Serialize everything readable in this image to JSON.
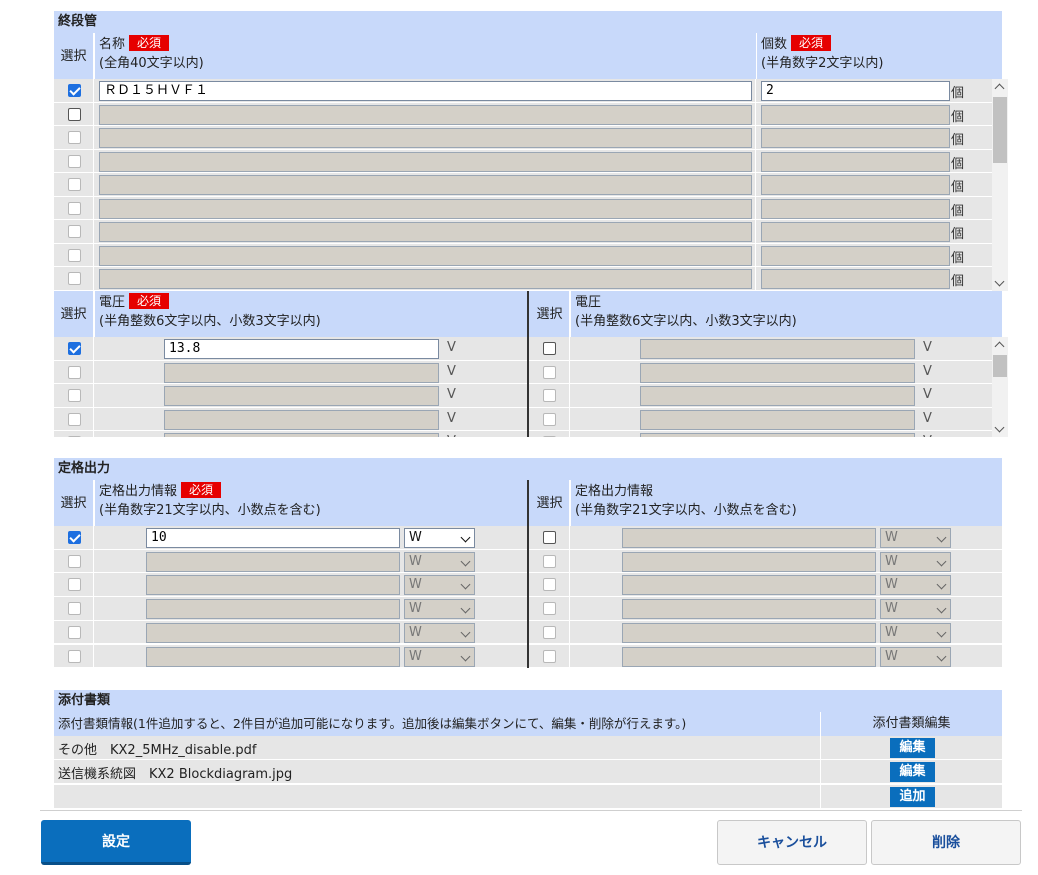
{
  "final_stage": {
    "title": "終段管",
    "header": {
      "select": "選択",
      "name_label": "名称",
      "name_required": "必須",
      "name_note": "(全角40文字以内)",
      "count_label": "個数",
      "count_required": "必須",
      "count_note": "(半角数字2文字以内)"
    },
    "rows": [
      {
        "checked": true,
        "enabled": true,
        "name": "ＲＤ１５ＨＶＦ１",
        "count": "2",
        "unit": "個"
      },
      {
        "checked": false,
        "enabled": true,
        "name": "",
        "count": "",
        "unit": "個"
      },
      {
        "checked": false,
        "enabled": false,
        "name": "",
        "count": "",
        "unit": "個"
      },
      {
        "checked": false,
        "enabled": false,
        "name": "",
        "count": "",
        "unit": "個"
      },
      {
        "checked": false,
        "enabled": false,
        "name": "",
        "count": "",
        "unit": "個"
      },
      {
        "checked": false,
        "enabled": false,
        "name": "",
        "count": "",
        "unit": "個"
      },
      {
        "checked": false,
        "enabled": false,
        "name": "",
        "count": "",
        "unit": "個"
      },
      {
        "checked": false,
        "enabled": false,
        "name": "",
        "count": "",
        "unit": "個"
      },
      {
        "checked": false,
        "enabled": false,
        "name": "",
        "count": "",
        "unit": "個"
      }
    ],
    "voltage_header": {
      "select": "選択",
      "label": "電圧",
      "required": "必須",
      "note": "(半角整数6文字以内、小数3文字以内)",
      "select2": "選択",
      "label2": "電圧",
      "note2": "(半角整数6文字以内、小数3文字以内)"
    },
    "voltage_rows": [
      {
        "left_checked": true,
        "left_enabled": true,
        "left_value": "13.8",
        "right_checked": false,
        "right_enabled": true,
        "right_value": "",
        "unit": "V"
      },
      {
        "left_checked": false,
        "left_enabled": false,
        "left_value": "",
        "right_checked": false,
        "right_enabled": false,
        "right_value": "",
        "unit": "V"
      },
      {
        "left_checked": false,
        "left_enabled": false,
        "left_value": "",
        "right_checked": false,
        "right_enabled": false,
        "right_value": "",
        "unit": "V"
      },
      {
        "left_checked": false,
        "left_enabled": false,
        "left_value": "",
        "right_checked": false,
        "right_enabled": false,
        "right_value": "",
        "unit": "V"
      },
      {
        "left_checked": false,
        "left_enabled": false,
        "left_value": "",
        "right_checked": false,
        "right_enabled": false,
        "right_value": "",
        "unit": "V"
      }
    ]
  },
  "rated_output": {
    "title": "定格出力",
    "header": {
      "select": "選択",
      "label": "定格出力情報",
      "required": "必須",
      "note": "(半角数字21文字以内、小数点を含む)",
      "select2": "選択",
      "label2": "定格出力情報",
      "note2": "(半角数字21文字以内、小数点を含む)"
    },
    "rows": [
      {
        "left_checked": true,
        "left_enabled": true,
        "left_value": "10",
        "left_unit": "W",
        "right_checked": false,
        "right_enabled": true,
        "right_value": "",
        "right_unit": "W"
      },
      {
        "left_checked": false,
        "left_enabled": false,
        "left_value": "",
        "left_unit": "W",
        "right_checked": false,
        "right_enabled": false,
        "right_value": "",
        "right_unit": "W"
      },
      {
        "left_checked": false,
        "left_enabled": false,
        "left_value": "",
        "left_unit": "W",
        "right_checked": false,
        "right_enabled": false,
        "right_value": "",
        "right_unit": "W"
      },
      {
        "left_checked": false,
        "left_enabled": false,
        "left_value": "",
        "left_unit": "W",
        "right_checked": false,
        "right_enabled": false,
        "right_value": "",
        "right_unit": "W"
      },
      {
        "left_checked": false,
        "left_enabled": false,
        "left_value": "",
        "left_unit": "W",
        "right_checked": false,
        "right_enabled": false,
        "right_value": "",
        "right_unit": "W"
      },
      {
        "left_checked": false,
        "left_enabled": false,
        "left_value": "",
        "left_unit": "W",
        "right_checked": false,
        "right_enabled": false,
        "right_value": "",
        "right_unit": "W"
      }
    ]
  },
  "attachments": {
    "title": "添付書類",
    "info_header": "添付書類情報(1件追加すると、2件目が追加可能になります。追加後は編集ボタンにて、編集・削除が行えます。)",
    "edit_header": "添付書類編集",
    "items": [
      {
        "text": "その他　KX2_5MHz_disable.pdf",
        "button": "編集"
      },
      {
        "text": "送信機系統図　KX2 Blockdiagram.jpg",
        "button": "編集"
      }
    ],
    "add_button": "追加"
  },
  "footer": {
    "set_button": "設定",
    "cancel_button": "キャンセル",
    "delete_button": "削除"
  },
  "colors": {
    "header_bg": "#c8d9fa",
    "required_badge": "#e60000",
    "primary_button": "#0a6ebd"
  }
}
